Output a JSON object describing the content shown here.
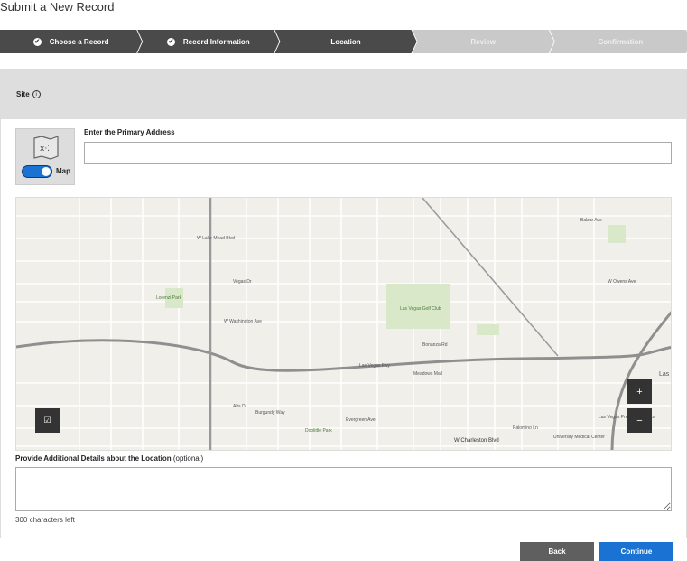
{
  "page_title": "Submit a New Record",
  "steps": [
    {
      "label": "Choose a Record",
      "state": "complete"
    },
    {
      "label": "Record Information",
      "state": "complete"
    },
    {
      "label": "Location",
      "state": "current"
    },
    {
      "label": "Review",
      "state": "todo"
    },
    {
      "label": "Confirmation",
      "state": "todo"
    }
  ],
  "section": {
    "title": "Site",
    "info_icon": "info-circle-icon"
  },
  "map_toggle": {
    "label": "Map",
    "on": true,
    "icon": "map-icon"
  },
  "address": {
    "label": "Enter the Primary Address",
    "value": ""
  },
  "map": {
    "labels": [
      "W Lake Mead Blvd",
      "Vegas Dr",
      "W Washington Ave",
      "Las Vegas Golf Club",
      "Bonanza Rd",
      "Las Vegas Fwy",
      "Meadows Mall",
      "Alta Dr",
      "Burgundy Way",
      "Evergreen Ave",
      "Palomino Ln",
      "W Charleston Blvd",
      "University Medical Center",
      "Las Vegas Premium Outlets",
      "Lorenzi Park",
      "Doolittle Park",
      "Balzar Ave",
      "W Owens Ave",
      "Las"
    ],
    "zoom_in": "+",
    "zoom_out": "−",
    "layer_icon": "☑"
  },
  "details": {
    "label": "Provide Additional Details about the Location",
    "optional": "(optional)",
    "value": "",
    "chars_left": "300 characters left"
  },
  "buttons": {
    "back": "Back",
    "continue": "Continue"
  },
  "colors": {
    "step_done": "#4a4a4a",
    "step_todo": "#c9c9c9",
    "primary": "#1a73d2",
    "back": "#5f5f5f"
  }
}
